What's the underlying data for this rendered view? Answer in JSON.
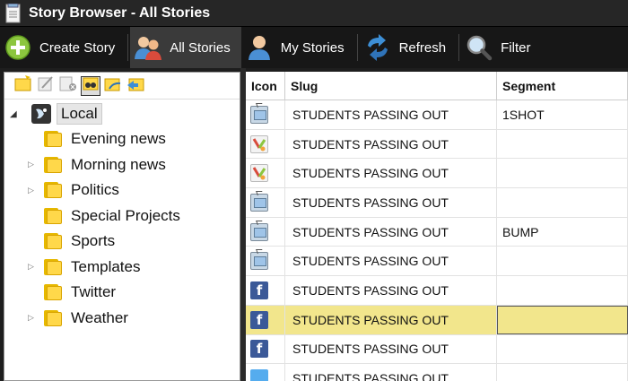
{
  "window": {
    "title": "Story Browser - All Stories"
  },
  "toolbar": {
    "create": "Create Story",
    "all": "All Stories",
    "mine": "My Stories",
    "refresh": "Refresh",
    "filter": "Filter"
  },
  "tree": {
    "root": "Local",
    "items": [
      {
        "label": "Evening news",
        "expandable": false
      },
      {
        "label": "Morning news",
        "expandable": true
      },
      {
        "label": "Politics",
        "expandable": true
      },
      {
        "label": "Special Projects",
        "expandable": false
      },
      {
        "label": "Sports",
        "expandable": false
      },
      {
        "label": "Templates",
        "expandable": true
      },
      {
        "label": "Twitter",
        "expandable": false
      },
      {
        "label": "Weather",
        "expandable": true
      }
    ]
  },
  "grid": {
    "columns": {
      "icon": "Icon",
      "slug": "Slug",
      "segment": "Segment"
    },
    "rows": [
      {
        "icon": "tv",
        "slug": "STUDENTS PASSING OUT",
        "segment": "1SHOT"
      },
      {
        "icon": "multi",
        "slug": "STUDENTS PASSING OUT",
        "segment": ""
      },
      {
        "icon": "multi",
        "slug": "STUDENTS PASSING OUT",
        "segment": ""
      },
      {
        "icon": "tv",
        "slug": "STUDENTS PASSING OUT",
        "segment": ""
      },
      {
        "icon": "tv",
        "slug": "STUDENTS PASSING OUT",
        "segment": "BUMP"
      },
      {
        "icon": "tv",
        "slug": "STUDENTS PASSING OUT",
        "segment": ""
      },
      {
        "icon": "facebook",
        "slug": "STUDENTS PASSING OUT",
        "segment": ""
      },
      {
        "icon": "facebook",
        "slug": "STUDENTS PASSING OUT",
        "segment": "",
        "selected": true
      },
      {
        "icon": "facebook",
        "slug": "STUDENTS PASSING OUT",
        "segment": ""
      },
      {
        "icon": "twitter",
        "slug": "STUDENTS PASSING OUT",
        "segment": ""
      }
    ]
  },
  "colors": {
    "selection": "#f2e68c",
    "toolbar_bg": "#171717",
    "title_bg": "#262626"
  }
}
